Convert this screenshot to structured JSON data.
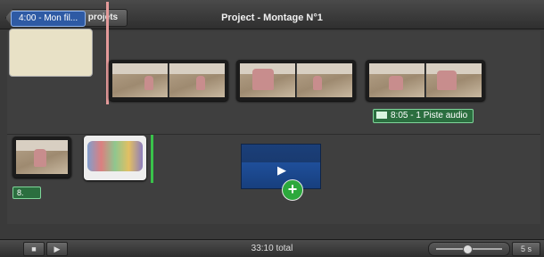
{
  "titlebar": {
    "library_button": "Bibliothèque de projets",
    "project_title": "Project - Montage N°1"
  },
  "timeline": {
    "title_clip_label": "4:00 - Mon fil...",
    "audio_badge": "8:05 - 1 Piste audio",
    "small_badge": "8."
  },
  "footer": {
    "total": "33:10 total",
    "zoom_value": "5 s"
  },
  "icons": [
    "play-icon",
    "play-fullscreen-icon",
    "add-plus-icon",
    "mouse-pointer-icon",
    "audio-track-icon"
  ],
  "colors": {
    "playhead": "#e49a9a",
    "title_badge": "#2e5aa4",
    "audio_badge": "#2b6e3f",
    "drop_indicator": "#39c24a"
  }
}
